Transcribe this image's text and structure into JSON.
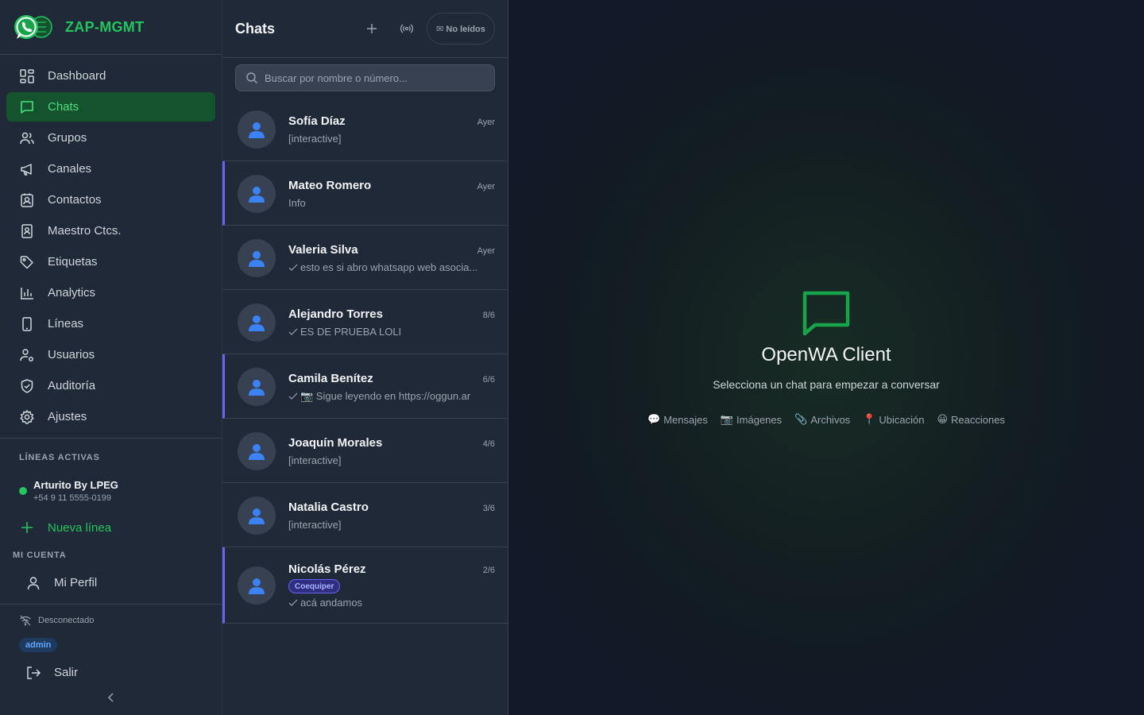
{
  "brand": {
    "name": "ZAP-MGMT"
  },
  "nav": [
    {
      "label": "Dashboard",
      "icon": "dashboard-icon"
    },
    {
      "label": "Chats",
      "icon": "chat-icon",
      "active": true
    },
    {
      "label": "Grupos",
      "icon": "users-icon"
    },
    {
      "label": "Canales",
      "icon": "megaphone-icon"
    },
    {
      "label": "Contactos",
      "icon": "contact-icon"
    },
    {
      "label": "Maestro Ctcs.",
      "icon": "address-book-icon"
    },
    {
      "label": "Etiquetas",
      "icon": "tag-icon"
    },
    {
      "label": "Analytics",
      "icon": "bar-chart-icon"
    },
    {
      "label": "Líneas",
      "icon": "phone-icon"
    },
    {
      "label": "Usuarios",
      "icon": "user-gear-icon"
    },
    {
      "label": "Auditoría",
      "icon": "shield-icon"
    },
    {
      "label": "Ajustes",
      "icon": "gear-icon"
    }
  ],
  "lines": {
    "section_label": "LÍNEAS ACTIVAS",
    "active": {
      "name": "Arturito By LPEG",
      "phone": "+54 9 11 5555-0199"
    },
    "new_line_label": "Nueva línea"
  },
  "account": {
    "section_label": "MI CUENTA",
    "profile_label": "Mi Perfil",
    "status": "Desconectado",
    "role": "admin",
    "logout_label": "Salir"
  },
  "chatlist": {
    "title": "Chats",
    "unread_label": "✉ No leídos",
    "search_placeholder": "Buscar por nombre o número...",
    "chats": [
      {
        "name": "Sofía Díaz",
        "time": "Ayer",
        "preview": "[interactive]",
        "check": false,
        "marked": false
      },
      {
        "name": "Mateo Romero",
        "time": "Ayer",
        "preview": "Info",
        "check": false,
        "marked": true
      },
      {
        "name": "Valeria Silva",
        "time": "Ayer",
        "preview": "esto es si abro whatsapp web asocia...",
        "check": true,
        "marked": false
      },
      {
        "name": "Alejandro Torres",
        "time": "8/6",
        "preview": "ES DE PRUEBA LOLI",
        "check": true,
        "marked": false
      },
      {
        "name": "Camila Benítez",
        "time": "6/6",
        "preview": "📷 Sigue leyendo en https://oggun.ar",
        "check": true,
        "marked": true
      },
      {
        "name": "Joaquín Morales",
        "time": "4/6",
        "preview": "[interactive]",
        "check": false,
        "marked": false
      },
      {
        "name": "Natalia Castro",
        "time": "3/6",
        "preview": "[interactive]",
        "check": false,
        "marked": false
      },
      {
        "name": "Nicolás Pérez",
        "time": "2/6",
        "preview": "acá andamos",
        "check": true,
        "marked": true,
        "tag": "Coequiper"
      }
    ]
  },
  "main": {
    "title": "OpenWA Client",
    "subtitle": "Selecciona un chat para empezar a conversar",
    "features": [
      {
        "glyph": "💬",
        "label": "Mensajes"
      },
      {
        "glyph": "📷",
        "label": "Imágenes"
      },
      {
        "glyph": "📎",
        "label": "Archivos"
      },
      {
        "glyph": "📍",
        "label": "Ubicación"
      },
      {
        "glyph": "😀",
        "label": "Reacciones"
      }
    ]
  },
  "colors": {
    "accent": "#22c55e",
    "marker": "#6366f1",
    "panel": "#1f2937",
    "background": "#111827"
  }
}
